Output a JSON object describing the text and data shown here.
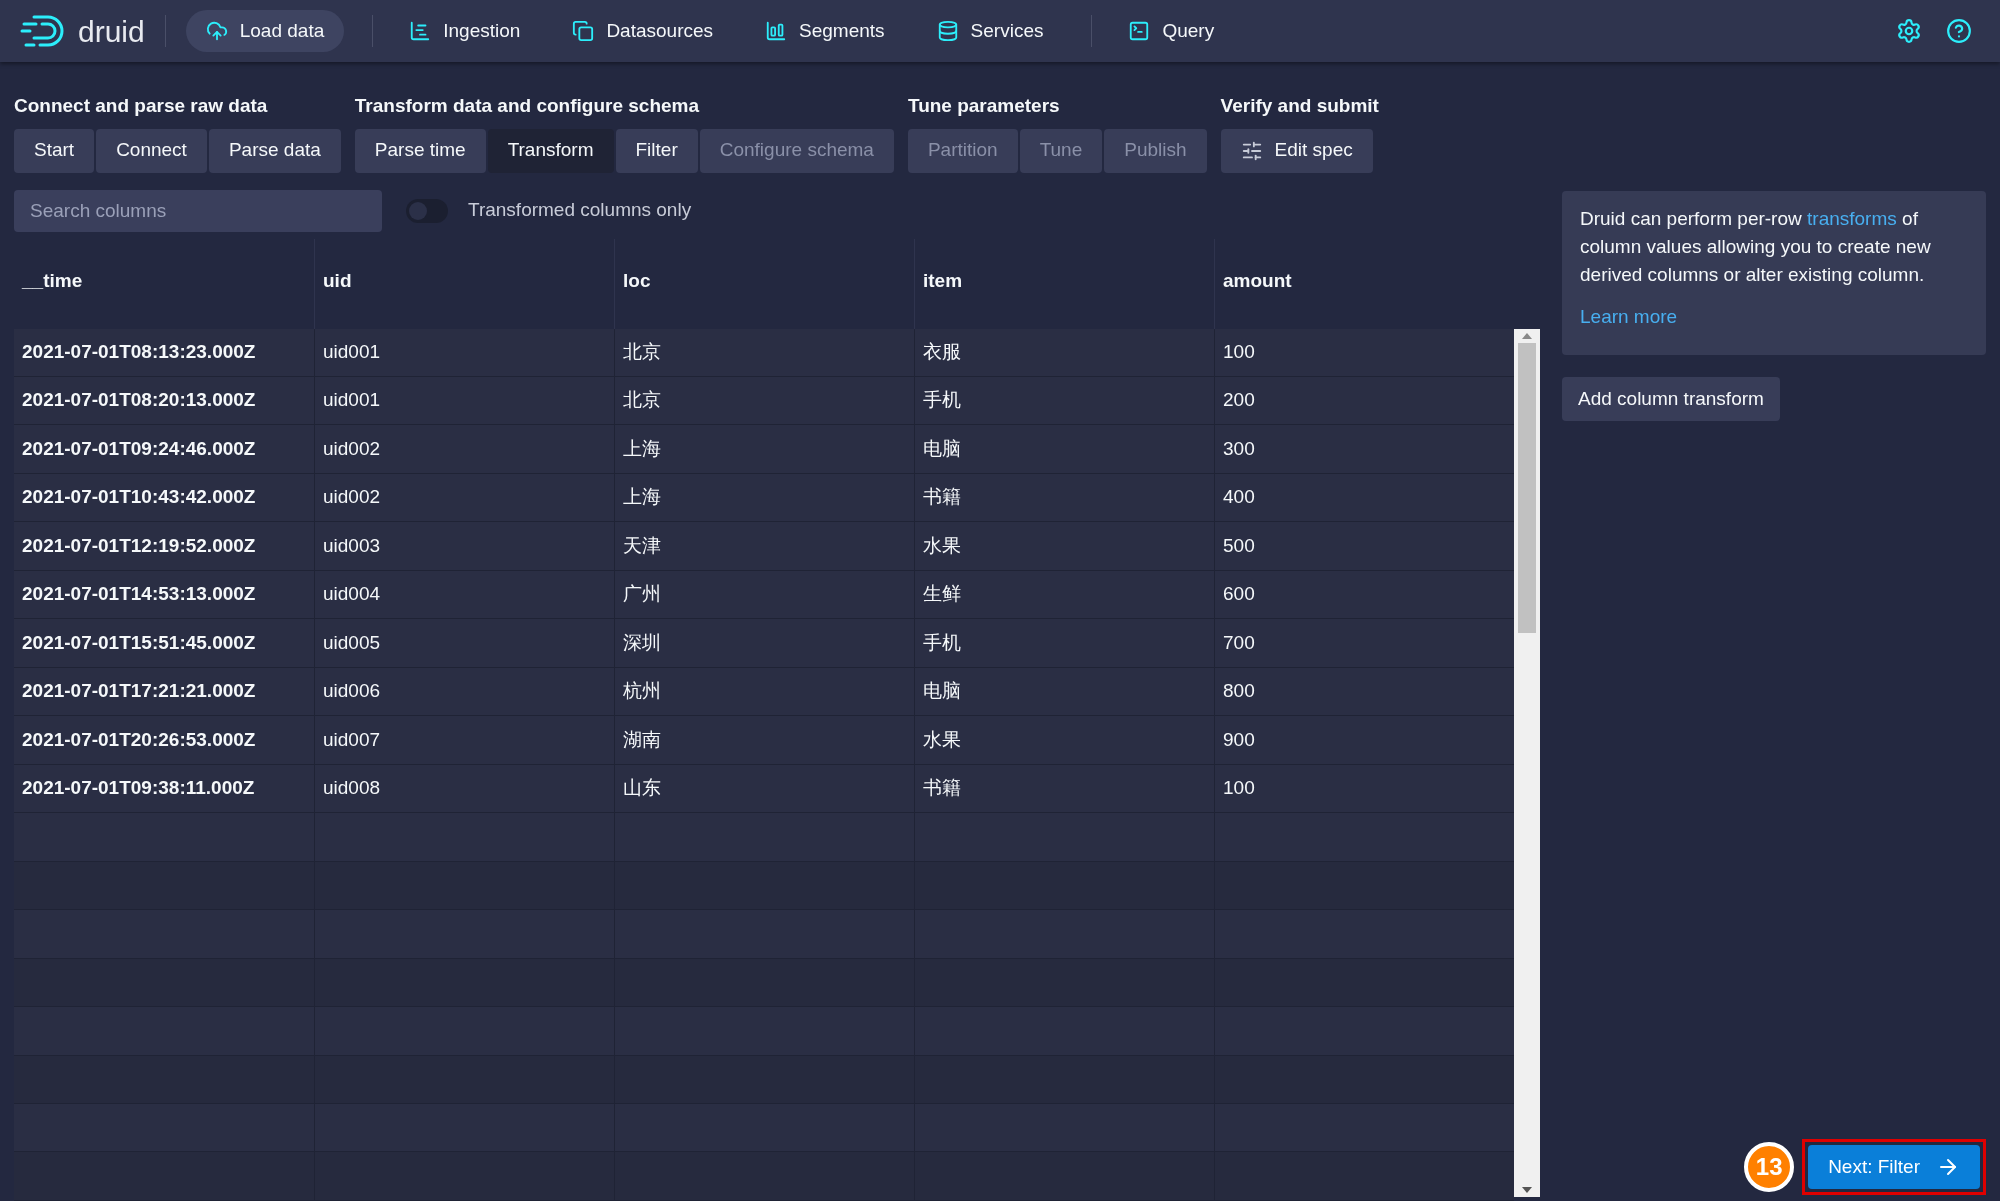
{
  "nav": {
    "logo": "druid",
    "items": [
      {
        "label": "Load data",
        "selected": true
      },
      {
        "label": "Ingestion",
        "selected": false
      },
      {
        "label": "Datasources",
        "selected": false
      },
      {
        "label": "Segments",
        "selected": false
      },
      {
        "label": "Services",
        "selected": false
      },
      {
        "label": "Query",
        "selected": false
      }
    ]
  },
  "steps": [
    {
      "title": "Connect and parse raw data",
      "items": [
        {
          "label": "Start",
          "selected": false,
          "disabled": false
        },
        {
          "label": "Connect",
          "selected": false,
          "disabled": false
        },
        {
          "label": "Parse data",
          "selected": false,
          "disabled": false
        }
      ]
    },
    {
      "title": "Transform data and configure schema",
      "items": [
        {
          "label": "Parse time",
          "selected": false,
          "disabled": false
        },
        {
          "label": "Transform",
          "selected": true,
          "disabled": false
        },
        {
          "label": "Filter",
          "selected": false,
          "disabled": false
        },
        {
          "label": "Configure schema",
          "selected": false,
          "disabled": true
        }
      ]
    },
    {
      "title": "Tune parameters",
      "items": [
        {
          "label": "Partition",
          "selected": false,
          "disabled": true
        },
        {
          "label": "Tune",
          "selected": false,
          "disabled": true
        },
        {
          "label": "Publish",
          "selected": false,
          "disabled": true
        }
      ]
    },
    {
      "title": "Verify and submit",
      "items": [
        {
          "label": "Edit spec",
          "selected": false,
          "disabled": false
        }
      ]
    }
  ],
  "search": {
    "placeholder": "Search columns"
  },
  "toggle": {
    "label": "Transformed columns only",
    "on": false
  },
  "table": {
    "columns": [
      "__time",
      "uid",
      "loc",
      "item",
      "amount"
    ],
    "rows": [
      [
        "2021-07-01T08:13:23.000Z",
        "uid001",
        "北京",
        "衣服",
        "100"
      ],
      [
        "2021-07-01T08:20:13.000Z",
        "uid001",
        "北京",
        "手机",
        "200"
      ],
      [
        "2021-07-01T09:24:46.000Z",
        "uid002",
        "上海",
        "电脑",
        "300"
      ],
      [
        "2021-07-01T10:43:42.000Z",
        "uid002",
        "上海",
        "书籍",
        "400"
      ],
      [
        "2021-07-01T12:19:52.000Z",
        "uid003",
        "天津",
        "水果",
        "500"
      ],
      [
        "2021-07-01T14:53:13.000Z",
        "uid004",
        "广州",
        "生鲜",
        "600"
      ],
      [
        "2021-07-01T15:51:45.000Z",
        "uid005",
        "深圳",
        "手机",
        "700"
      ],
      [
        "2021-07-01T17:21:21.000Z",
        "uid006",
        "杭州",
        "电脑",
        "800"
      ],
      [
        "2021-07-01T20:26:53.000Z",
        "uid007",
        "湖南",
        "水果",
        "900"
      ],
      [
        "2021-07-01T09:38:11.000Z",
        "uid008",
        "山东",
        "书籍",
        "100"
      ]
    ]
  },
  "info": {
    "before": "Druid can perform per-row ",
    "link": "transforms",
    "after": " of column values allowing you to create new derived columns or alter existing column.",
    "learn_more": "Learn more"
  },
  "add_button": "Add column transform",
  "next_button": "Next: Filter",
  "annotation": {
    "label": "13"
  }
}
